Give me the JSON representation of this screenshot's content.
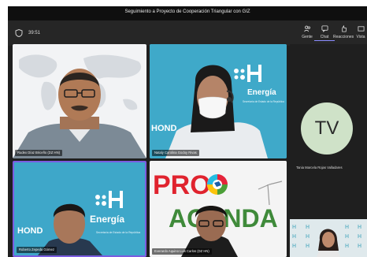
{
  "window": {
    "title": "Seguimiento a Proyecto de Cooperación Triangular con GIZ"
  },
  "toolbar": {
    "timer": "39:51",
    "items": [
      {
        "label": "Gente",
        "icon": "people-icon"
      },
      {
        "label": "Chat",
        "icon": "chat-icon"
      },
      {
        "label": "Reacciones",
        "icon": "reactions-icon"
      },
      {
        "label": "Vista",
        "icon": "view-icon"
      }
    ]
  },
  "participants": [
    {
      "name": "Rudex Díaz Briceño (DZ HN)"
    },
    {
      "name": "Nataly Carolina Godoy Rivas"
    },
    {
      "name": "Roberto Zepeda Gómez"
    },
    {
      "name": "Everardo Aquino Luis Carlos (DZ HN)"
    }
  ],
  "side_participant": {
    "initials": "TV",
    "name": "Tania Marcela Rojas Valladares"
  },
  "tile_content": {
    "logo_word": "HOND",
    "energy_word": "Energía",
    "subtitle_line": "Secretaría de Estado de la República",
    "pro_text": "PRO",
    "agenda_text": "AGENDA"
  },
  "colors": {
    "energy_bg": "#3fa9c9",
    "accent": "#8b8cff",
    "avatar_bg": "#cfe2c8"
  }
}
